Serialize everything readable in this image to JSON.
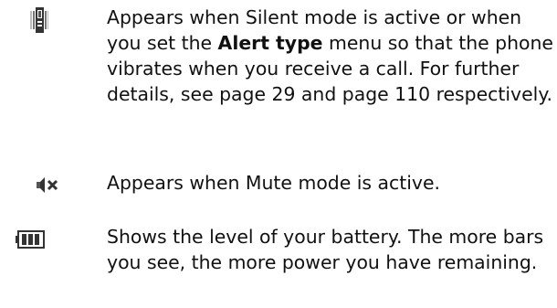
{
  "entries": [
    {
      "icon": "vibrate-icon",
      "text_before": "Appears when Silent mode is active or when you set the ",
      "bold": "Alert type",
      "text_after": " menu so that the phone vibrates when you receive a call. For further details, see page 29 and page 110 respectively."
    },
    {
      "icon": "mute-icon",
      "text": "Appears when Mute mode is active."
    },
    {
      "icon": "battery-icon",
      "text": "Shows the level of your battery. The more bars you see, the more power you have remaining."
    }
  ],
  "colors": {
    "icon_dark": "#333333",
    "icon_mid": "#777777",
    "icon_light": "#bbbbbb"
  }
}
